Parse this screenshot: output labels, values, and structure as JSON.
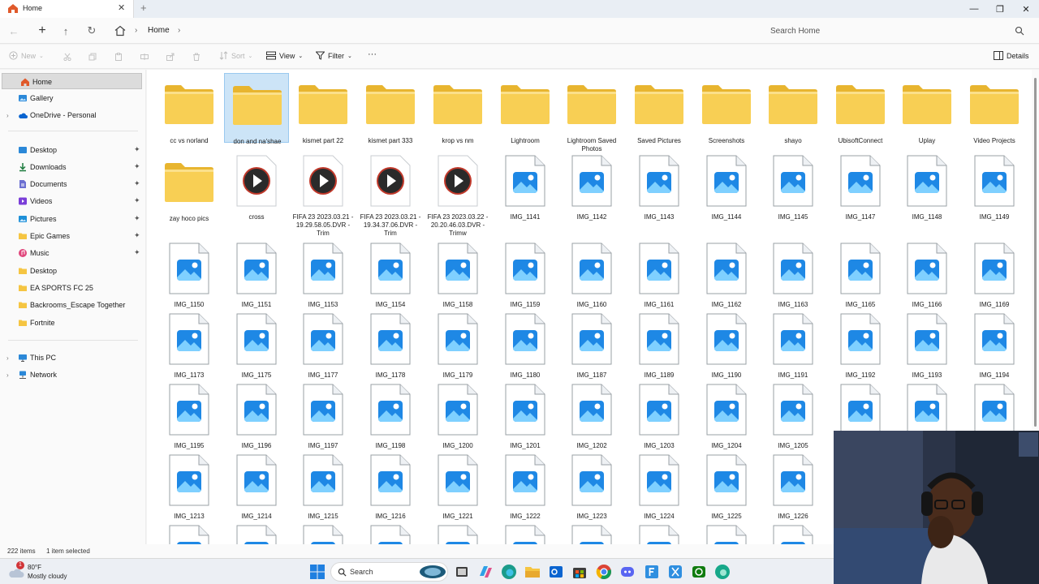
{
  "window": {
    "tab_title": "Home",
    "tab_close": "✕",
    "new_tab": "+",
    "min": "—",
    "max": "❐",
    "close": "✕"
  },
  "address": {
    "back": "←",
    "forward": "→",
    "up": "↑",
    "refresh": "↻",
    "sep": "›",
    "crumb": "Home",
    "search_placeholder": "Search Home"
  },
  "toolbar": {
    "new_label": "New",
    "sort_label": "Sort",
    "view_label": "View",
    "filter_label": "Filter",
    "more_label": "···",
    "details_label": "Details"
  },
  "sidebar": {
    "home": "Home",
    "gallery": "Gallery",
    "onedrive": "OneDrive - Personal",
    "desktop": "Desktop",
    "downloads": "Downloads",
    "documents": "Documents",
    "videos": "Videos",
    "pictures": "Pictures",
    "epic": "Epic Games",
    "music": "Music",
    "desktop2": "Desktop",
    "easports": "EA SPORTS FC 25",
    "backrooms": "Backrooms_Escape Together",
    "fortnite": "Fortnite",
    "thispc": "This PC",
    "network": "Network",
    "expand": "›",
    "pin": "📌"
  },
  "items": {
    "f0": "cc vs norland",
    "f1": "don and na'shae",
    "f2": "kismet part 22",
    "f3": "kismet part 333",
    "f4": "krop vs nm",
    "f5": "Lightroom",
    "f6": "Lightroom Saved Photos",
    "f7": "Saved Pictures",
    "f8": "Screenshots",
    "f9": "shayo",
    "f10": "UbisoftConnect",
    "f11": "Uplay",
    "f12": "Video Projects",
    "r1_0": "zay hoco pics",
    "r1_1": "cross",
    "r1_2": "FIFA 23 2023.03.21 - 19.29.58.05.DVR - Trim",
    "r1_3": "FIFA 23 2023.03.21 - 19.34.37.06.DVR - Trim",
    "r1_4": "FIFA 23 2023.03.22 - 20.20.46.03.DVR - Trimw",
    "r1_5": "IMG_1141",
    "r1_6": "IMG_1142",
    "r1_7": "IMG_1143",
    "r1_8": "IMG_1144",
    "r1_9": "IMG_1145",
    "r1_10": "IMG_1147",
    "r1_11": "IMG_1148",
    "r1_12": "IMG_1149",
    "r2_0": "IMG_1150",
    "r2_1": "IMG_1151",
    "r2_2": "IMG_1153",
    "r2_3": "IMG_1154",
    "r2_4": "IMG_1158",
    "r2_5": "IMG_1159",
    "r2_6": "IMG_1160",
    "r2_7": "IMG_1161",
    "r2_8": "IMG_1162",
    "r2_9": "IMG_1163",
    "r2_10": "IMG_1165",
    "r2_11": "IMG_1166",
    "r2_12": "IMG_1169",
    "r3_0": "IMG_1173",
    "r3_1": "IMG_1175",
    "r3_2": "IMG_1177",
    "r3_3": "IMG_1178",
    "r3_4": "IMG_1179",
    "r3_5": "IMG_1180",
    "r3_6": "IMG_1187",
    "r3_7": "IMG_1189",
    "r3_8": "IMG_1190",
    "r3_9": "IMG_1191",
    "r3_10": "IMG_1192",
    "r3_11": "IMG_1193",
    "r3_12": "IMG_1194",
    "r4_0": "IMG_1195",
    "r4_1": "IMG_1196",
    "r4_2": "IMG_1197",
    "r4_3": "IMG_1198",
    "r4_4": "IMG_1200",
    "r4_5": "IMG_1201",
    "r4_6": "IMG_1202",
    "r4_7": "IMG_1203",
    "r4_8": "IMG_1204",
    "r4_9": "IMG_1205",
    "r5_0": "IMG_1213",
    "r5_1": "IMG_1214",
    "r5_2": "IMG_1215",
    "r5_3": "IMG_1216",
    "r5_4": "IMG_1221",
    "r5_5": "IMG_1222",
    "r5_6": "IMG_1223",
    "r5_7": "IMG_1224",
    "r5_8": "IMG_1225",
    "r5_9": "IMG_1226"
  },
  "status": {
    "count": "222 items",
    "selected": "1 item selected"
  },
  "taskbar": {
    "temp": "80°F",
    "desc": "Mostly cloudy",
    "badge": "1",
    "search_label": "Search"
  },
  "colors": {
    "accent": "#0067c0",
    "folder": "#f8cf54",
    "selection": "#cce4f7"
  }
}
